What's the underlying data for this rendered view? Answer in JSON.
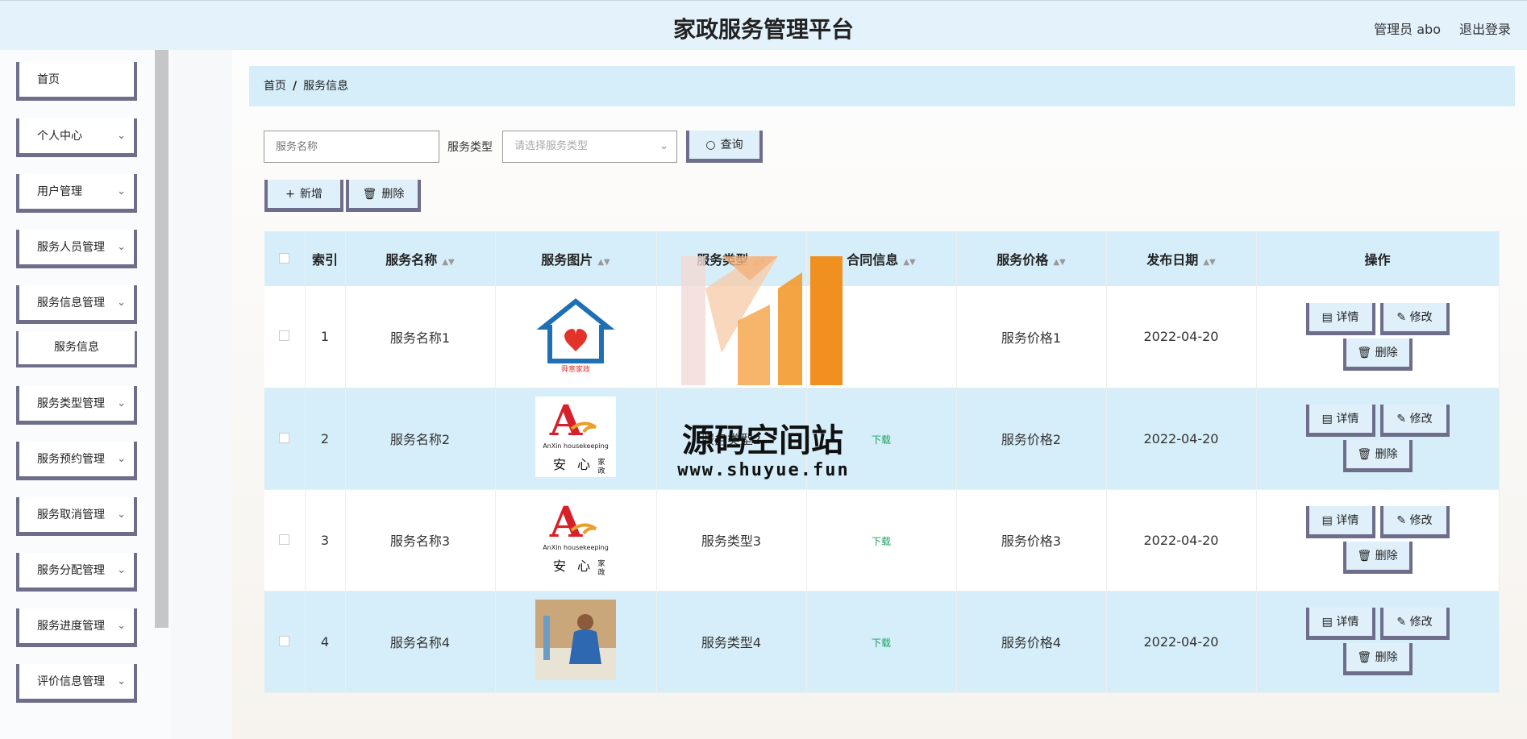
{
  "header": {
    "title": "家政服务管理平台",
    "admin": "管理员 abo",
    "logout": "退出登录"
  },
  "sidebar": {
    "items": [
      {
        "label": "首页",
        "has_arrow": false
      },
      {
        "label": "个人中心",
        "has_arrow": true
      },
      {
        "label": "用户管理",
        "has_arrow": true
      },
      {
        "label": "服务人员管理",
        "has_arrow": true
      },
      {
        "label": "服务信息管理",
        "has_arrow": true
      },
      {
        "label": "服务信息",
        "sub": true
      },
      {
        "label": "服务类型管理",
        "has_arrow": true
      },
      {
        "label": "服务预约管理",
        "has_arrow": true
      },
      {
        "label": "服务取消管理",
        "has_arrow": true
      },
      {
        "label": "服务分配管理",
        "has_arrow": true
      },
      {
        "label": "服务进度管理",
        "has_arrow": true
      },
      {
        "label": "评价信息管理",
        "has_arrow": true
      }
    ]
  },
  "breadcrumb": {
    "home": "首页",
    "sep": "/",
    "current": "服务信息"
  },
  "search": {
    "name_placeholder": "服务名称",
    "type_label": "服务类型",
    "type_placeholder": "请选择服务类型",
    "query_button": "查询"
  },
  "toolbar": {
    "add": "新增",
    "delete": "删除"
  },
  "table": {
    "headers": [
      "索引",
      "服务名称",
      "服务图片",
      "服务类型",
      "合同信息",
      "服务价格",
      "发布日期",
      "操作"
    ],
    "rows": [
      {
        "index": "1",
        "name": "服务名称1",
        "type": "",
        "contract": "",
        "price": "服务价格1",
        "date": "2022-04-20",
        "image": "house-logo"
      },
      {
        "index": "2",
        "name": "服务名称2",
        "type": "服务类型2",
        "contract": "下载",
        "price": "服务价格2",
        "date": "2022-04-20",
        "image": "anxin-logo"
      },
      {
        "index": "3",
        "name": "服务名称3",
        "type": "服务类型3",
        "contract": "下载",
        "price": "服务价格3",
        "date": "2022-04-20",
        "image": "anxin-logo"
      },
      {
        "index": "4",
        "name": "服务名称4",
        "type": "服务类型4",
        "contract": "下载",
        "price": "服务价格4",
        "date": "2022-04-20",
        "image": "cleaning-photo"
      }
    ],
    "row_buttons": {
      "detail": "详情",
      "edit": "修改",
      "delete": "删除"
    }
  },
  "watermark": {
    "text": "源码空间站",
    "url": "www.shuyue.fun"
  },
  "colors": {
    "header_bg": "#e3f2fb",
    "row_highlight": "#d6eef9",
    "button_border": "#6e6e8a",
    "download_link": "#19a15f"
  }
}
